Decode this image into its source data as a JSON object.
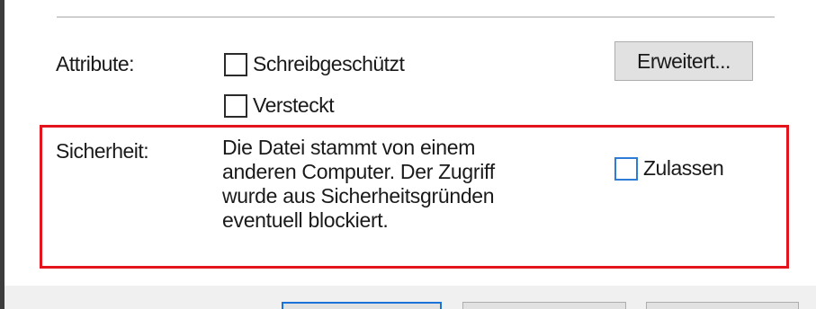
{
  "attributes": {
    "label": "Attribute:",
    "readonly_label": "Schreibgeschützt",
    "hidden_label": "Versteckt",
    "advanced_button": "Erweitert..."
  },
  "security": {
    "label": "Sicherheit:",
    "lines": [
      "Die Datei stammt von einem",
      "anderen Computer. Der Zugriff",
      "wurde aus Sicherheitsgründen",
      "eventuell blockiert."
    ],
    "allow_label": "Zulassen"
  },
  "colors": {
    "highlight": "#e3141b",
    "focus_blue": "#2f7cd6"
  }
}
